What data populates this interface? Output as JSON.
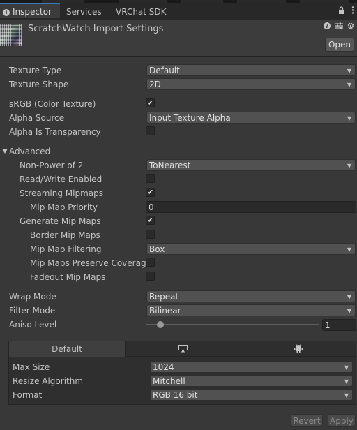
{
  "tabs": [
    {
      "label": "Inspector",
      "active": true
    },
    {
      "label": "Services",
      "active": false
    },
    {
      "label": "VRChat SDK",
      "active": false
    }
  ],
  "tabbar_icons": [
    "lock-icon",
    "kebab-menu-icon"
  ],
  "header": {
    "title": "ScratchWatch Import Settings",
    "open_label": "Open",
    "icons": [
      "help-icon",
      "preset-icon",
      "settings-icon"
    ]
  },
  "fields": {
    "texture_type": {
      "label": "Texture Type",
      "value": "Default"
    },
    "texture_shape": {
      "label": "Texture Shape",
      "value": "2D"
    },
    "srgb": {
      "label": "sRGB (Color Texture)",
      "checked": true
    },
    "alpha_source": {
      "label": "Alpha Source",
      "value": "Input Texture Alpha"
    },
    "alpha_transparency": {
      "label": "Alpha Is Transparency",
      "checked": false
    },
    "advanced": {
      "label": "Advanced",
      "expanded": true
    },
    "non_power_of_2": {
      "label": "Non-Power of 2",
      "value": "ToNearest"
    },
    "read_write": {
      "label": "Read/Write Enabled",
      "checked": false
    },
    "streaming_mipmaps": {
      "label": "Streaming Mipmaps",
      "checked": true
    },
    "mip_map_priority": {
      "label": "Mip Map Priority",
      "value": "0"
    },
    "generate_mip_maps": {
      "label": "Generate Mip Maps",
      "checked": true
    },
    "border_mip_maps": {
      "label": "Border Mip Maps",
      "checked": false
    },
    "mip_map_filtering": {
      "label": "Mip Map Filtering",
      "value": "Box"
    },
    "mip_maps_preserve_coverage": {
      "label": "Mip Maps Preserve Coverage",
      "checked": false
    },
    "fadeout_mip_maps": {
      "label": "Fadeout Mip Maps",
      "checked": false
    },
    "wrap_mode": {
      "label": "Wrap Mode",
      "value": "Repeat"
    },
    "filter_mode": {
      "label": "Filter Mode",
      "value": "Bilinear"
    },
    "aniso_level": {
      "label": "Aniso Level",
      "value": "1",
      "min": 0,
      "max": 16
    }
  },
  "platform": {
    "tabs": [
      {
        "label": "Default",
        "active": true
      },
      {
        "icon": "monitor-icon",
        "active": false
      },
      {
        "icon": "android-icon",
        "active": false
      }
    ],
    "max_size": {
      "label": "Max Size",
      "value": "1024"
    },
    "resize_algorithm": {
      "label": "Resize Algorithm",
      "value": "Mitchell"
    },
    "format": {
      "label": "Format",
      "value": "RGB 16 bit"
    }
  },
  "buttons": {
    "revert": "Revert",
    "apply": "Apply"
  }
}
